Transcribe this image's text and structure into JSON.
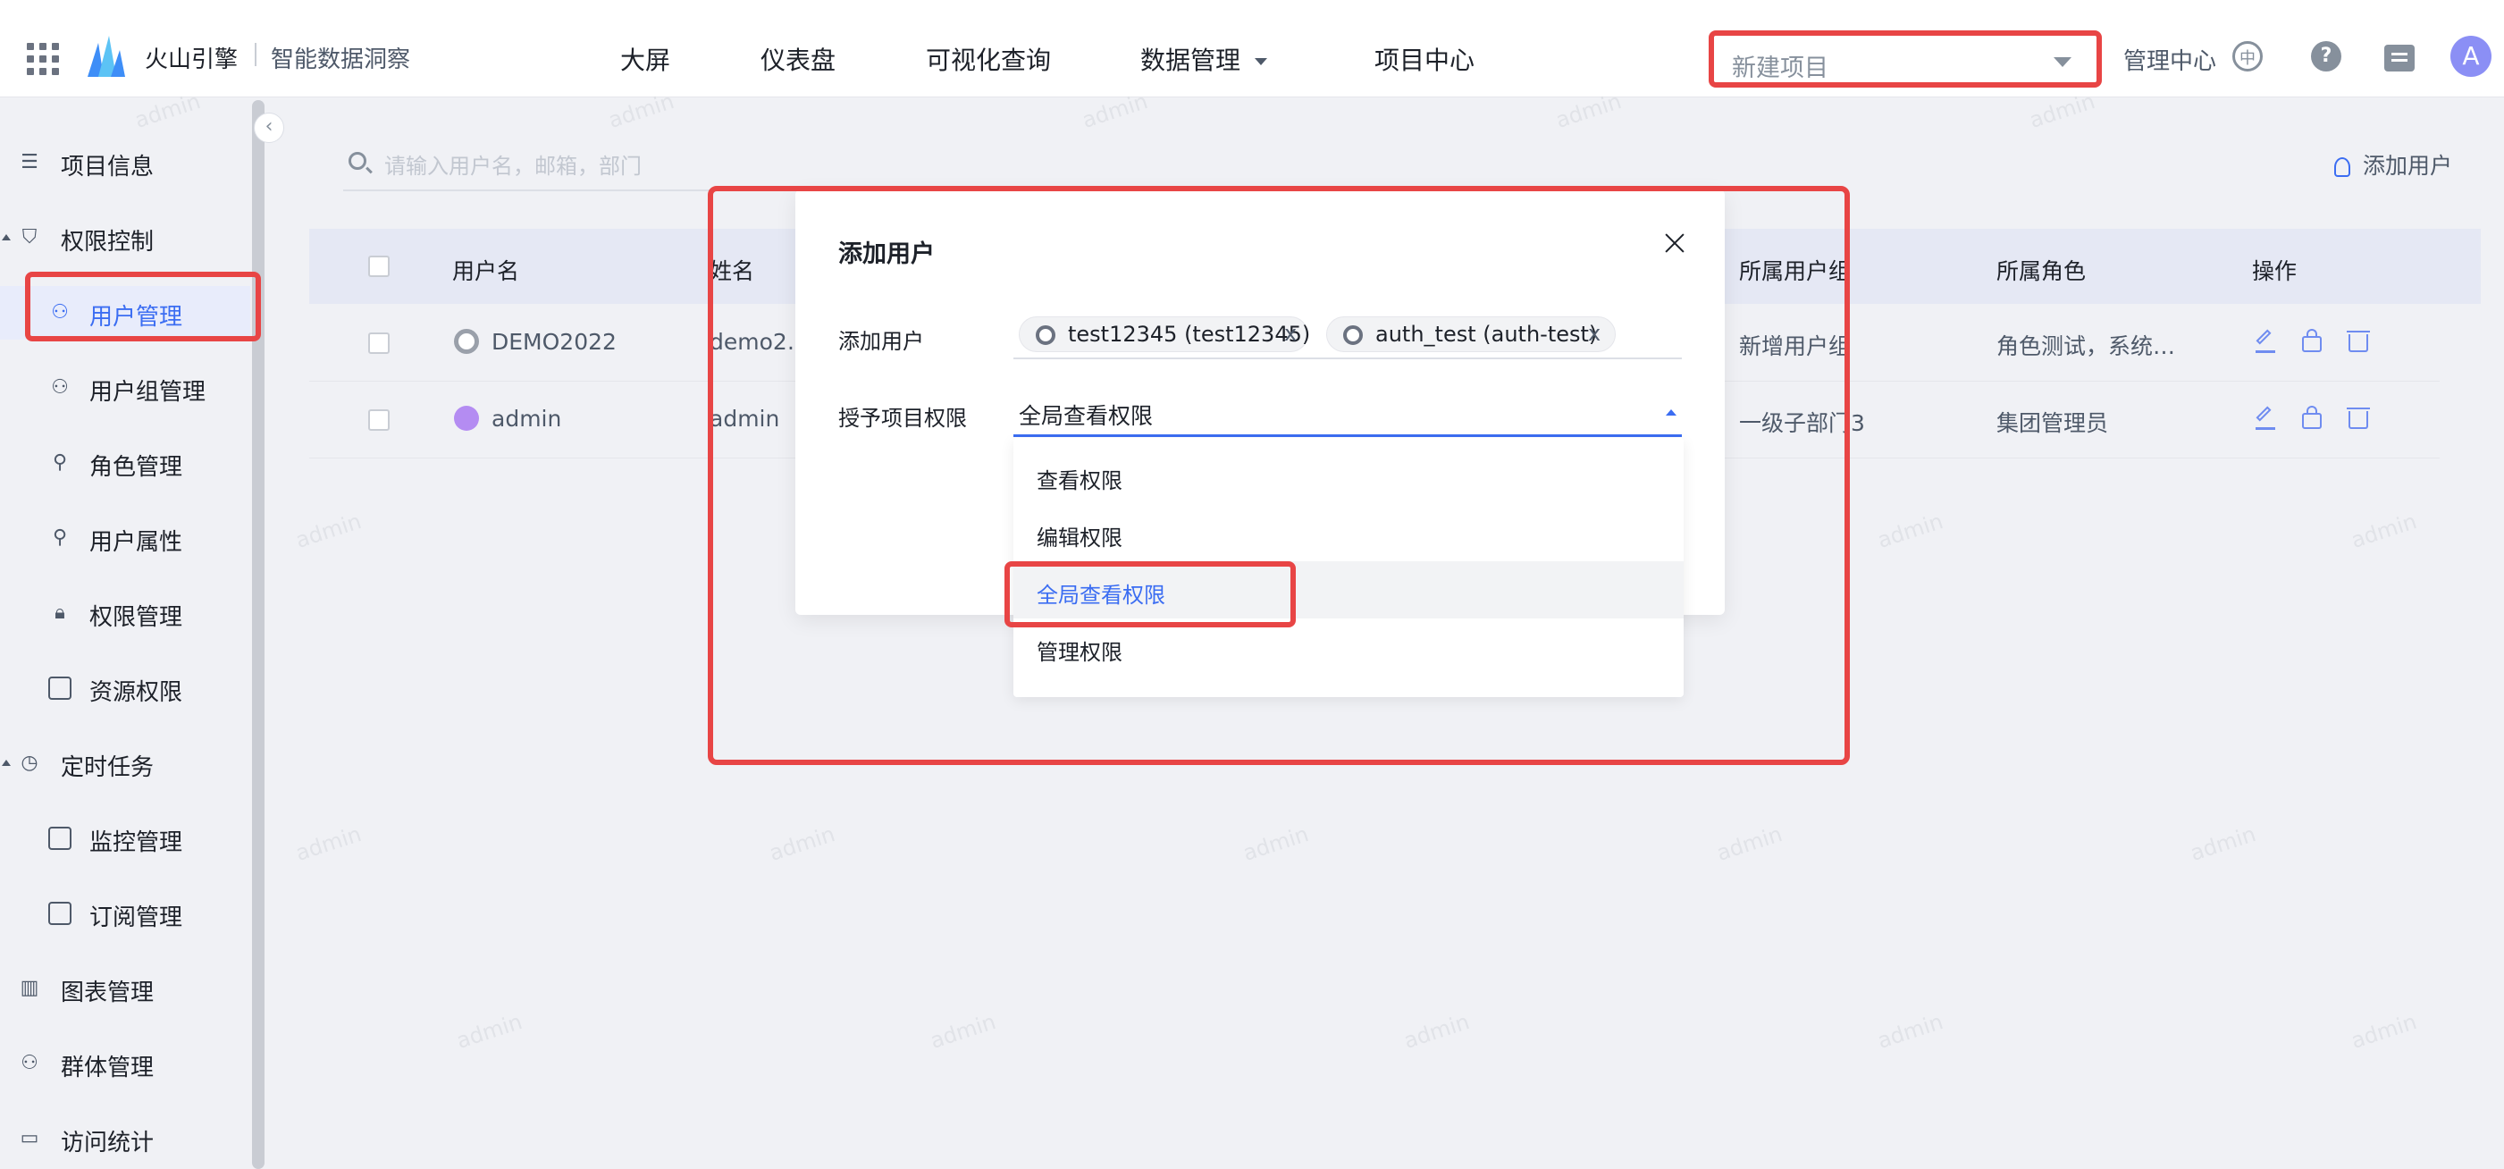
{
  "header": {
    "brand": "火山引擎",
    "product": "智能数据洞察",
    "nav": [
      "大屏",
      "仪表盘",
      "可视化查询",
      "数据管理",
      "项目中心"
    ],
    "project_select": "新建项目",
    "admin_center": "管理中心",
    "avatar_letter": "A"
  },
  "sidebar": {
    "items": [
      {
        "label": "项目信息",
        "icon": "list-icon"
      },
      {
        "label": "权限控制",
        "icon": "shield-icon"
      },
      {
        "label": "用户管理",
        "icon": "user-icon"
      },
      {
        "label": "用户组管理",
        "icon": "users-icon"
      },
      {
        "label": "角色管理",
        "icon": "role-icon"
      },
      {
        "label": "用户属性",
        "icon": "user-attr-icon"
      },
      {
        "label": "权限管理",
        "icon": "lock-icon"
      },
      {
        "label": "资源权限",
        "icon": "resource-icon"
      },
      {
        "label": "定时任务",
        "icon": "clock-icon"
      },
      {
        "label": "监控管理",
        "icon": "monitor-icon"
      },
      {
        "label": "订阅管理",
        "icon": "bookmark-icon"
      },
      {
        "label": "图表管理",
        "icon": "chart-icon"
      },
      {
        "label": "群体管理",
        "icon": "group-icon"
      },
      {
        "label": "访问统计",
        "icon": "stats-icon"
      }
    ]
  },
  "main": {
    "search_placeholder": "请输入用户名，邮箱，部门",
    "add_user": "添加用户",
    "columns": [
      "用户名",
      "姓名",
      "所属用户组",
      "所属角色",
      "操作"
    ],
    "rows": [
      {
        "username": "DEMO2022",
        "name": "demo2…",
        "group": "新增用户组",
        "role": "角色测试，系统…"
      },
      {
        "username": "admin",
        "name": "admin",
        "group": "一级子部门3",
        "role": "集团管理员"
      }
    ]
  },
  "modal": {
    "title": "添加用户",
    "add_user_label": "添加用户",
    "tags": [
      "test12345 (test12345)",
      "auth_test (auth-test)"
    ],
    "tag_close": "x",
    "permission_label": "授予项目权限",
    "permission_value": "全局查看权限",
    "options": [
      "查看权限",
      "编辑权限",
      "全局查看权限",
      "管理权限"
    ]
  },
  "watermark": "admin",
  "colors": {
    "accent": "#3b6df2",
    "highlight": "#e84545"
  }
}
